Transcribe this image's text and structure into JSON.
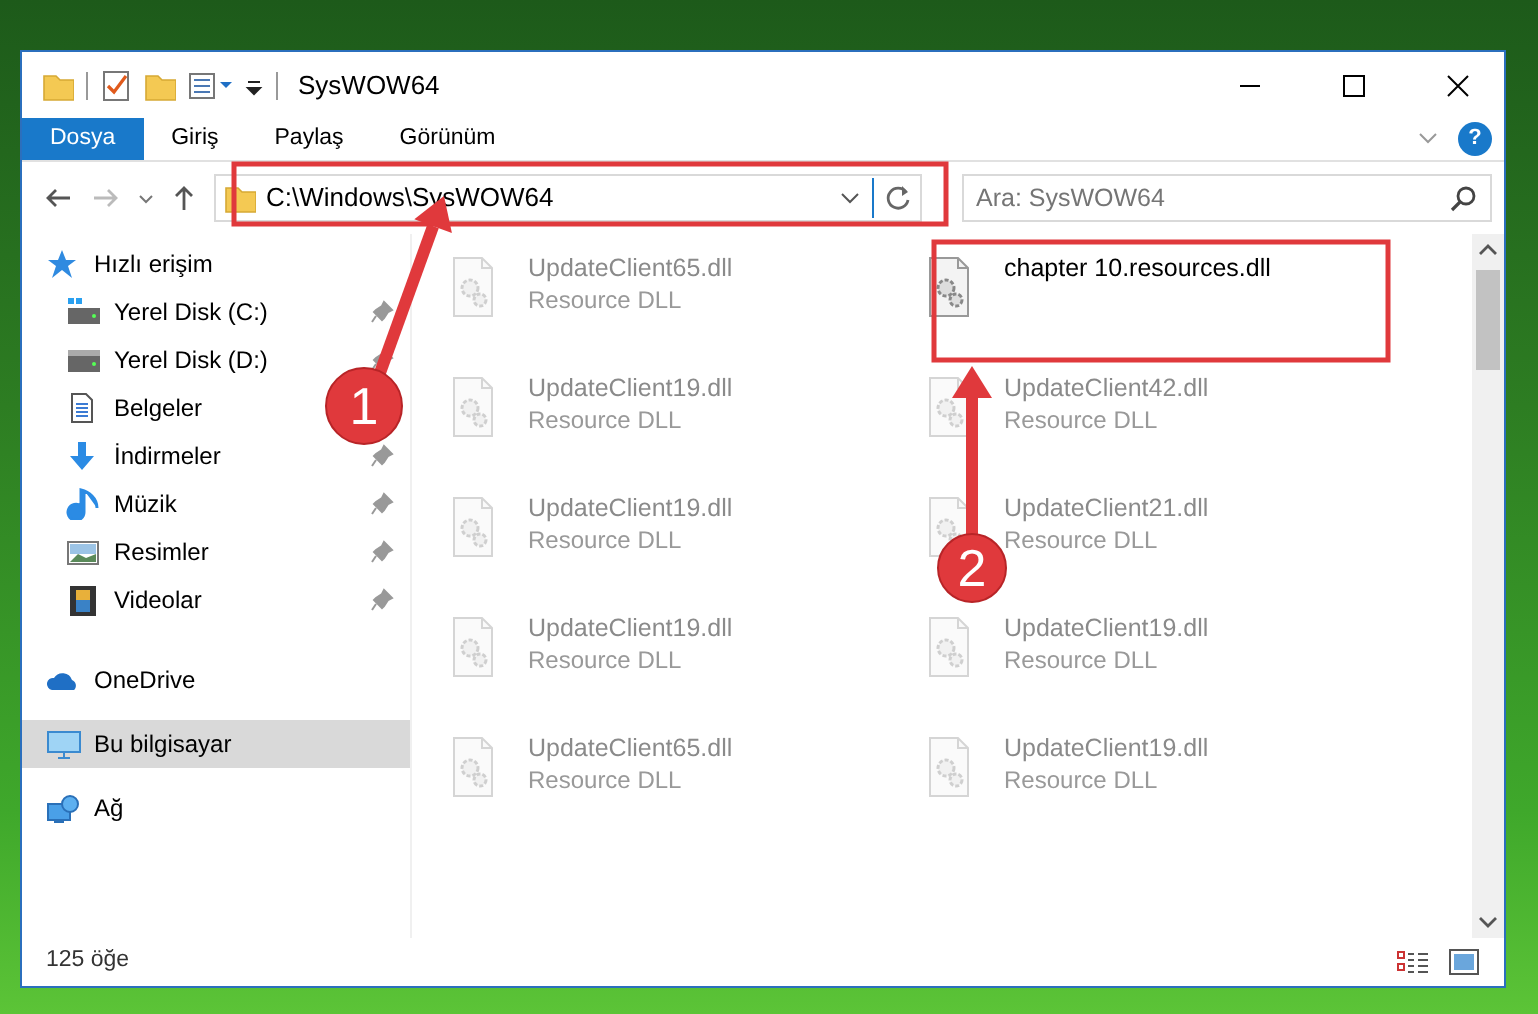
{
  "window": {
    "title": "SysWOW64"
  },
  "ribbon_tabs": [
    {
      "label": "Dosya",
      "selected": true
    },
    {
      "label": "Giriş",
      "selected": false
    },
    {
      "label": "Paylaş",
      "selected": false
    },
    {
      "label": "Görünüm",
      "selected": false
    }
  ],
  "help_button": {
    "label": "?"
  },
  "address_bar": {
    "path": "C:\\Windows\\SysWOW64"
  },
  "search": {
    "placeholder": "Ara: SysWOW64"
  },
  "sidebar": {
    "items": [
      {
        "label": "Hızlı erişim",
        "kind": "star",
        "selected": false,
        "children": [
          {
            "label": "Yerel Disk (C:)",
            "kind": "disk-c",
            "pinned": true,
            "selected": false
          },
          {
            "label": "Yerel Disk (D:)",
            "kind": "disk",
            "pinned": true,
            "selected": false
          },
          {
            "label": "Belgeler",
            "kind": "docs",
            "pinned": false,
            "selected": false
          },
          {
            "label": "İndirmeler",
            "kind": "download",
            "pinned": true,
            "selected": false
          },
          {
            "label": "Müzik",
            "kind": "music",
            "pinned": true,
            "selected": false
          },
          {
            "label": "Resimler",
            "kind": "pictures",
            "pinned": true,
            "selected": false
          },
          {
            "label": "Videolar",
            "kind": "video",
            "pinned": true,
            "selected": false
          }
        ]
      },
      {
        "label": "OneDrive",
        "kind": "cloud",
        "selected": false
      },
      {
        "label": "Bu bilgisayar",
        "kind": "pc",
        "selected": true
      },
      {
        "label": "Ağ",
        "kind": "network",
        "selected": false
      }
    ]
  },
  "files": [
    {
      "name": "UpdateClient65.dll",
      "type": "Resource DLL",
      "faded": true
    },
    {
      "name": "chapter 10.resources.dll",
      "faded": false
    },
    {
      "name": "UpdateClient19.dll",
      "type": "Resource DLL",
      "faded": true
    },
    {
      "name": "UpdateClient42.dll",
      "type": "Resource DLL",
      "faded": true
    },
    {
      "name": "UpdateClient19.dll",
      "type": "Resource DLL",
      "faded": true
    },
    {
      "name": "UpdateClient21.dll",
      "type": "Resource DLL",
      "faded": true
    },
    {
      "name": "UpdateClient19.dll",
      "type": "Resource DLL",
      "faded": true
    },
    {
      "name": "UpdateClient19.dll",
      "type": "Resource DLL",
      "faded": true
    },
    {
      "name": "UpdateClient65.dll",
      "type": "Resource DLL",
      "faded": true
    },
    {
      "name": "UpdateClient19.dll",
      "type": "Resource DLL",
      "faded": true
    }
  ],
  "status_bar": {
    "item_count": "125 öğe"
  },
  "annotations": [
    {
      "number": "1"
    },
    {
      "number": "2"
    }
  ]
}
